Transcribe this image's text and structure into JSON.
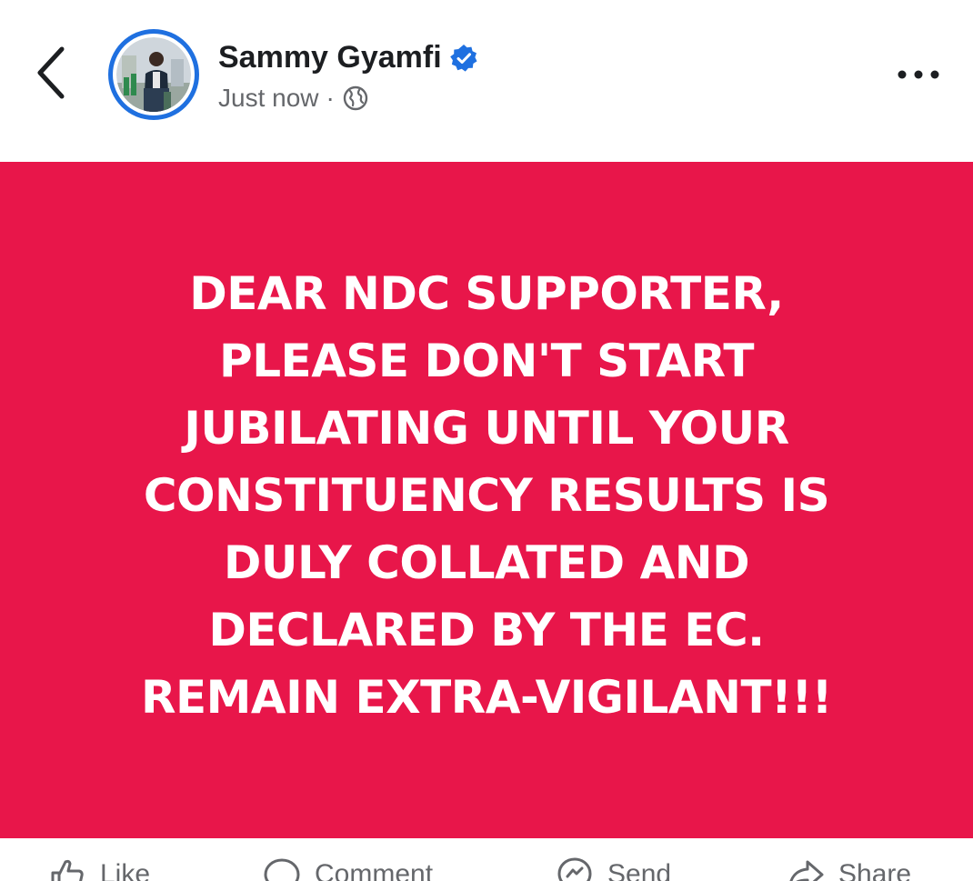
{
  "post": {
    "author_name": "Sammy Gyamfi",
    "verified": true,
    "timestamp": "Just now",
    "separator": "·",
    "audience_icon": "globe-icon",
    "background_color": "#e8164a",
    "text_lines": [
      "DEAR NDC SUPPORTER,",
      "PLEASE DON'T START",
      "JUBILATING UNTIL YOUR",
      "CONSTITUENCY RESULTS IS",
      "DULY COLLATED AND",
      "DECLARED BY THE EC.",
      "REMAIN EXTRA-VIGILANT!!!"
    ]
  },
  "header": {
    "back_icon": "chevron-left-icon",
    "more_icon": "more-horizontal-icon",
    "verified_icon": "verified-badge-icon",
    "accent_color": "#1f70e0"
  },
  "actions": [
    {
      "label": "Like",
      "icon": "thumbs-up-icon"
    },
    {
      "label": "Comment",
      "icon": "comment-icon"
    },
    {
      "label": "Send",
      "icon": "send-icon"
    },
    {
      "label": "Share",
      "icon": "share-icon"
    }
  ]
}
